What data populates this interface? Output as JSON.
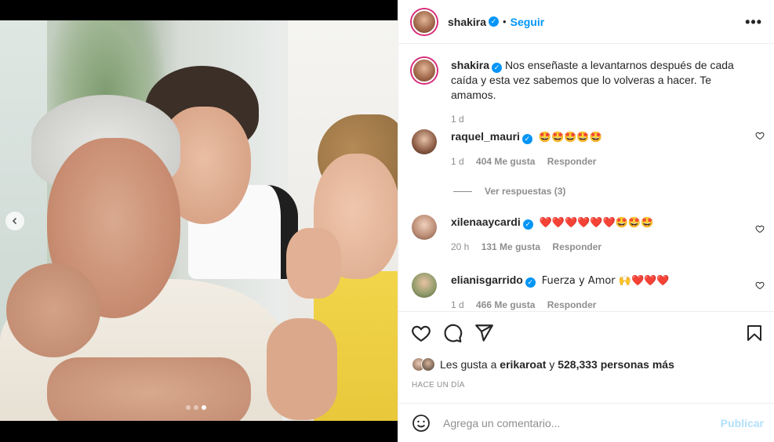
{
  "post": {
    "username": "shakira",
    "follow_label": "Seguir",
    "separator": "•",
    "more_label": "•••"
  },
  "caption": {
    "username": "shakira",
    "text": "Nos enseñaste a levantarnos después de cada caída y esta vez sabemos que lo volveras a hacer. Te amamos.",
    "time": "1 d"
  },
  "comments": [
    {
      "username": "raquel_mauri",
      "text": "🤩🤩🤩🤩🤩",
      "time": "1 d",
      "likes": "404 Me gusta",
      "reply": "Responder"
    },
    {
      "username": "xilenaaycardi",
      "text": "❤️❤️❤️❤️❤️❤️🤩🤩🤩",
      "time": "20 h",
      "likes": "131 Me gusta",
      "reply": "Responder"
    },
    {
      "username": "elianisgarrido",
      "text": "Fuerza y Amor 🙌❤️❤️❤️",
      "time": "1 d",
      "likes": "466 Me gusta",
      "reply": "Responder"
    }
  ],
  "replies_label": "Ver respuestas (3)",
  "likes_summary": {
    "prefix": "Les gusta a",
    "user": "erikaroat",
    "middle": "y",
    "count": "528,333 personas más"
  },
  "date_label": "HACE UN DÍA",
  "composer": {
    "placeholder": "Agrega un comentario...",
    "publish_label": "Publicar"
  },
  "carousel": {
    "total": 3,
    "active": 3
  },
  "colors": {
    "accent": "#0095f6",
    "muted": "#8e8e8e",
    "publish_disabled": "#b2dffc"
  }
}
